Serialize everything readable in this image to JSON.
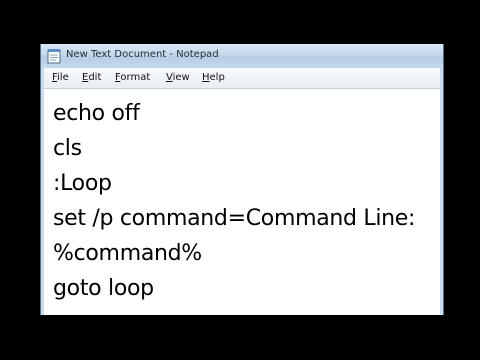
{
  "window": {
    "title": "New Text Document - Notepad",
    "app_icon": "notepad-icon"
  },
  "menu": {
    "items": [
      {
        "label": "File"
      },
      {
        "label": "Edit"
      },
      {
        "label": "Format"
      },
      {
        "label": "View"
      },
      {
        "label": "Help"
      }
    ]
  },
  "editor": {
    "lines": [
      "echo off",
      "cls",
      ":Loop",
      "set /p command=Command Line:",
      "%command%",
      "goto loop"
    ]
  },
  "colors": {
    "background": "#000000",
    "titlebar": "#c4d8ec",
    "editor_background": "#ffffff",
    "text": "#000000"
  }
}
